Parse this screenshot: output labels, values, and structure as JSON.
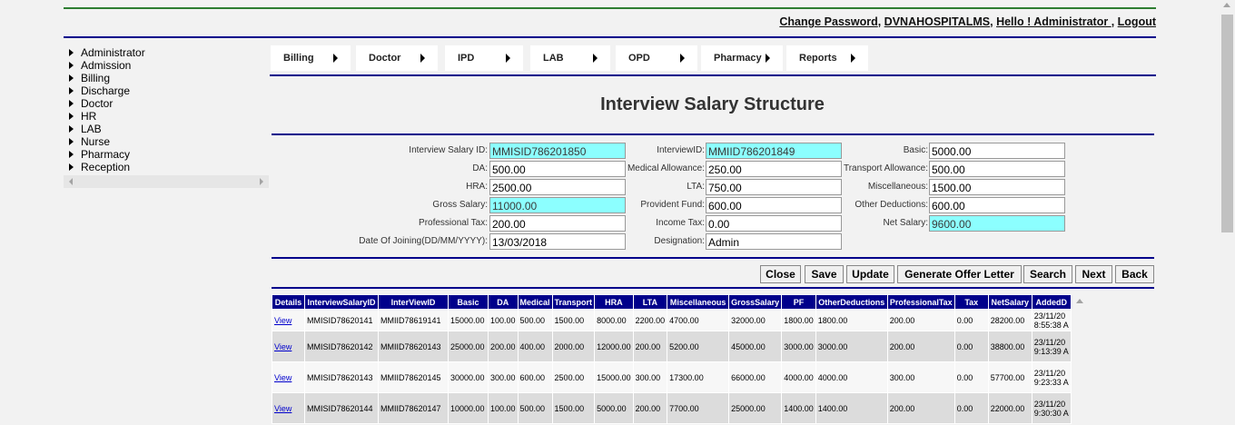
{
  "header": {
    "change_password": "Change Password",
    "sep1": ", ",
    "hospital": "DVNAHOSPITALMS",
    "sep2": ", ",
    "greeting": "Hello ! Administrator ",
    "sep3": ", ",
    "logout": "Logout"
  },
  "sidebar": {
    "items": [
      "Administrator",
      "Admission",
      "Billing",
      "Discharge",
      "Doctor",
      "HR",
      "LAB",
      "Nurse",
      "Pharmacy",
      "Reception"
    ]
  },
  "menu": {
    "items": [
      "Billing",
      "Doctor",
      "IPD",
      "LAB",
      "OPD",
      "Pharmacy",
      "Reports"
    ]
  },
  "page_title": "Interview Salary Structure",
  "form": {
    "interview_salary_id": {
      "label": "Interview Salary ID:",
      "value": "MMISID786201850"
    },
    "interview_id": {
      "label": "InterviewID:",
      "value": "MMIID786201849"
    },
    "basic": {
      "label": "Basic:",
      "value": "5000.00"
    },
    "da": {
      "label": "DA:",
      "value": "500.00"
    },
    "medical_allowance": {
      "label": "Medical Allowance:",
      "value": "250.00"
    },
    "transport_allowance": {
      "label": "Transport Allowance:",
      "value": "500.00"
    },
    "hra": {
      "label": "HRA:",
      "value": "2500.00"
    },
    "lta": {
      "label": "LTA:",
      "value": "750.00"
    },
    "miscellaneous": {
      "label": "Miscellaneous:",
      "value": "1500.00"
    },
    "gross_salary": {
      "label": "Gross Salary:",
      "value": "11000.00"
    },
    "provident_fund": {
      "label": "Provident Fund:",
      "value": "600.00"
    },
    "other_deductions": {
      "label": "Other Deductions:",
      "value": "600.00"
    },
    "professional_tax": {
      "label": "Professional Tax:",
      "value": "200.00"
    },
    "income_tax": {
      "label": "Income Tax:",
      "value": "0.00"
    },
    "net_salary": {
      "label": "Net Salary:",
      "value": "9600.00"
    },
    "date_of_joining": {
      "label": "Date Of Joining(DD/MM/YYYY):",
      "value": "13/03/2018"
    },
    "designation": {
      "label": "Designation:",
      "value": "Admin"
    }
  },
  "buttons": {
    "close": "Close",
    "save": "Save",
    "update": "Update",
    "offer": "Generate Offer Letter",
    "search": "Search",
    "next": "Next",
    "back": "Back"
  },
  "table": {
    "headers": [
      "Details",
      "InterviewSalaryID",
      "InterViewID",
      "Basic",
      "DA",
      "Medical",
      "Transport",
      "HRA",
      "LTA",
      "Miscellaneous",
      "GrossSalary",
      "PF",
      "OtherDeductions",
      "ProfessionalTax",
      "Tax",
      "NetSalary",
      "AddedD"
    ],
    "rows": [
      {
        "link": "View",
        "id": "MMISID78620141",
        "iid": "MMIID78619141",
        "basic": "15000.00",
        "da": "100.00",
        "med": "500.00",
        "trans": "1500.00",
        "hra": "8000.00",
        "lta": "2200.00",
        "misc": "4700.00",
        "gross": "32000.00",
        "pf": "1800.00",
        "other": "1800.00",
        "ptax": "200.00",
        "tax": "0.00",
        "net": "28200.00",
        "date": "23/11/20",
        "time": "8:55:38 A"
      },
      {
        "link": "View",
        "id": "MMISID78620142",
        "iid": "MMIID78620143",
        "basic": "25000.00",
        "da": "200.00",
        "med": "400.00",
        "trans": "2000.00",
        "hra": "12000.00",
        "lta": "200.00",
        "misc": "5200.00",
        "gross": "45000.00",
        "pf": "3000.00",
        "other": "3000.00",
        "ptax": "200.00",
        "tax": "0.00",
        "net": "38800.00",
        "date": "23/11/20",
        "time": "9:13:39 A"
      },
      {
        "link": "View",
        "id": "MMISID78620143",
        "iid": "MMIID78620145",
        "basic": "30000.00",
        "da": "300.00",
        "med": "600.00",
        "trans": "2500.00",
        "hra": "15000.00",
        "lta": "300.00",
        "misc": "17300.00",
        "gross": "66000.00",
        "pf": "4000.00",
        "other": "4000.00",
        "ptax": "300.00",
        "tax": "0.00",
        "net": "57700.00",
        "date": "23/11/20",
        "time": "9:23:33 A"
      },
      {
        "link": "View",
        "id": "MMISID78620144",
        "iid": "MMIID78620147",
        "basic": "10000.00",
        "da": "100.00",
        "med": "500.00",
        "trans": "1500.00",
        "hra": "5000.00",
        "lta": "200.00",
        "misc": "7700.00",
        "gross": "25000.00",
        "pf": "1400.00",
        "other": "1400.00",
        "ptax": "200.00",
        "tax": "0.00",
        "net": "22000.00",
        "date": "23/11/20",
        "time": "9:30:30 A"
      }
    ]
  },
  "colors": {
    "nav_blue": "#00008b",
    "highlight_cyan": "#8cffff",
    "top_green": "#2e7d32"
  }
}
